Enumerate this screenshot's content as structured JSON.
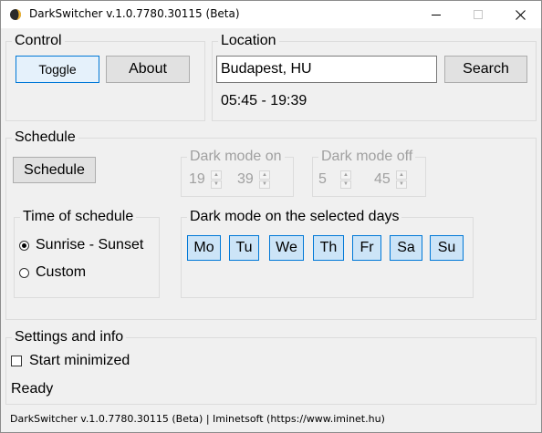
{
  "window": {
    "title": "DarkSwitcher v.1.0.7780.30115 (Beta)"
  },
  "control": {
    "legend": "Control",
    "toggle_label": "Toggle",
    "about_label": "About"
  },
  "location": {
    "legend": "Location",
    "value": "Budapest, HU",
    "search_label": "Search",
    "times": "05:45 - 19:39"
  },
  "schedule": {
    "legend": "Schedule",
    "button_label": "Schedule",
    "dark_on": {
      "legend": "Dark mode on",
      "hour": "19",
      "minute": "39"
    },
    "dark_off": {
      "legend": "Dark mode off",
      "hour": "5",
      "minute": "45"
    },
    "time_of_schedule": {
      "legend": "Time of schedule",
      "options": [
        "Sunrise - Sunset",
        "Custom"
      ],
      "selected": "Sunrise - Sunset"
    },
    "days": {
      "legend": "Dark mode on the selected days",
      "items": [
        "Mo",
        "Tu",
        "We",
        "Th",
        "Fr",
        "Sa",
        "Su"
      ]
    }
  },
  "settings": {
    "legend": "Settings and info",
    "start_minimized_label": "Start minimized",
    "start_minimized_checked": false,
    "status": "Ready"
  },
  "footer": {
    "text": "DarkSwitcher v.1.0.7780.30115 (Beta) | Iminetsoft (https://www.iminet.hu)"
  },
  "colors": {
    "accent": "#0078d7",
    "selected_day_bg": "#cce4f7",
    "window_bg": "#f0f0f0",
    "disabled_text": "#a0a0a0"
  }
}
